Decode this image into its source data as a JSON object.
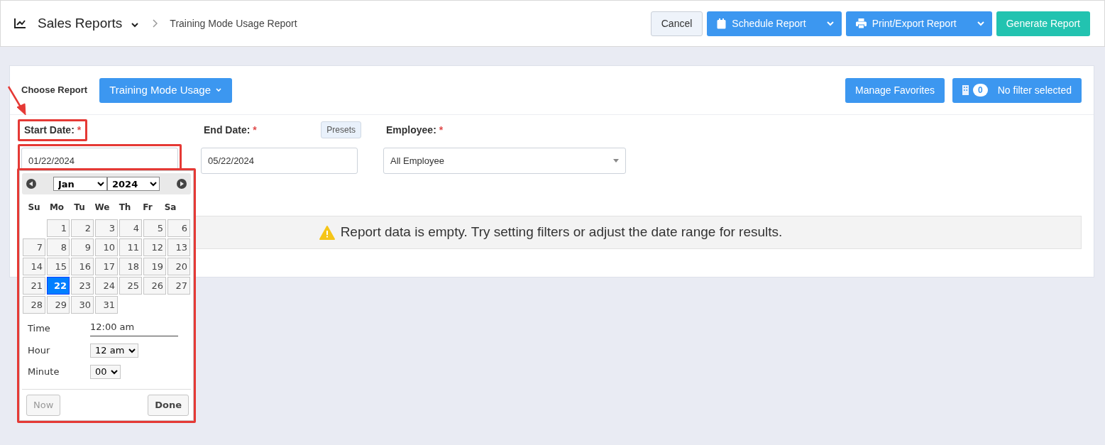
{
  "header": {
    "title": "Sales Reports",
    "breadcrumb": "Training Mode Usage Report",
    "buttons": [
      {
        "kind": "light",
        "label": "Cancel"
      },
      {
        "kind": "split-calendar",
        "label": "Schedule Report"
      },
      {
        "kind": "split-printer",
        "label": "Print/Export Report"
      },
      {
        "kind": "success",
        "label": "Generate Report"
      }
    ]
  },
  "report": {
    "label": "Choose Report",
    "selected_report": "Training Mode Usage",
    "favorites_button": "Manage Favorites",
    "filter_count": "0",
    "filter_text": "No filter selected"
  },
  "fields": [
    {
      "kind": "date",
      "label": "Start Date:",
      "required_mark": "*",
      "value": "01/22/2024",
      "highlighted": true
    },
    {
      "kind": "date",
      "label": "End Date:",
      "required_mark": "*",
      "value": "05/22/2024",
      "presets": "Presets",
      "highlighted": false
    },
    {
      "kind": "select",
      "label": "Employee:",
      "required_mark": "*",
      "value": "All Employee",
      "highlighted": false
    }
  ],
  "message": "Report data is empty. Try setting filters or adjust the date range for results.",
  "pointer_arrow": true,
  "calendar": {
    "highlighted": true,
    "month": "Jan",
    "year": "2024",
    "weekdays": [
      "Su",
      "Mo",
      "Tu",
      "We",
      "Th",
      "Fr",
      "Sa"
    ],
    "weeks": [
      {
        "starts_midweek": true,
        "days": [
          {
            "label": "1",
            "selected": false
          },
          {
            "label": "2",
            "selected": false
          },
          {
            "label": "3",
            "selected": false
          },
          {
            "label": "4",
            "selected": false
          },
          {
            "label": "5",
            "selected": false
          },
          {
            "label": "6",
            "selected": false
          }
        ]
      },
      {
        "starts_midweek": false,
        "days": [
          {
            "label": "7",
            "selected": false
          },
          {
            "label": "8",
            "selected": false
          },
          {
            "label": "9",
            "selected": false
          },
          {
            "label": "10",
            "selected": false
          },
          {
            "label": "11",
            "selected": false
          },
          {
            "label": "12",
            "selected": false
          },
          {
            "label": "13",
            "selected": false
          }
        ]
      },
      {
        "starts_midweek": false,
        "days": [
          {
            "label": "14",
            "selected": false
          },
          {
            "label": "15",
            "selected": false
          },
          {
            "label": "16",
            "selected": false
          },
          {
            "label": "17",
            "selected": false
          },
          {
            "label": "18",
            "selected": false
          },
          {
            "label": "19",
            "selected": false
          },
          {
            "label": "20",
            "selected": false
          }
        ]
      },
      {
        "starts_midweek": false,
        "days": [
          {
            "label": "21",
            "selected": false
          },
          {
            "label": "22",
            "selected": true
          },
          {
            "label": "23",
            "selected": false
          },
          {
            "label": "24",
            "selected": false
          },
          {
            "label": "25",
            "selected": false
          },
          {
            "label": "26",
            "selected": false
          },
          {
            "label": "27",
            "selected": false
          }
        ]
      },
      {
        "starts_midweek": false,
        "days": [
          {
            "label": "28",
            "selected": false
          },
          {
            "label": "29",
            "selected": false
          },
          {
            "label": "30",
            "selected": false
          },
          {
            "label": "31",
            "selected": false
          }
        ]
      }
    ],
    "time_label": "Time",
    "time_value": "12:00 am",
    "hour_label": "Hour",
    "hour_value": "12 am",
    "minute_label": "Minute",
    "minute_value": "00",
    "now_button": {
      "label": "Now",
      "disabled": true
    },
    "done_button": {
      "label": "Done",
      "disabled": false
    }
  }
}
